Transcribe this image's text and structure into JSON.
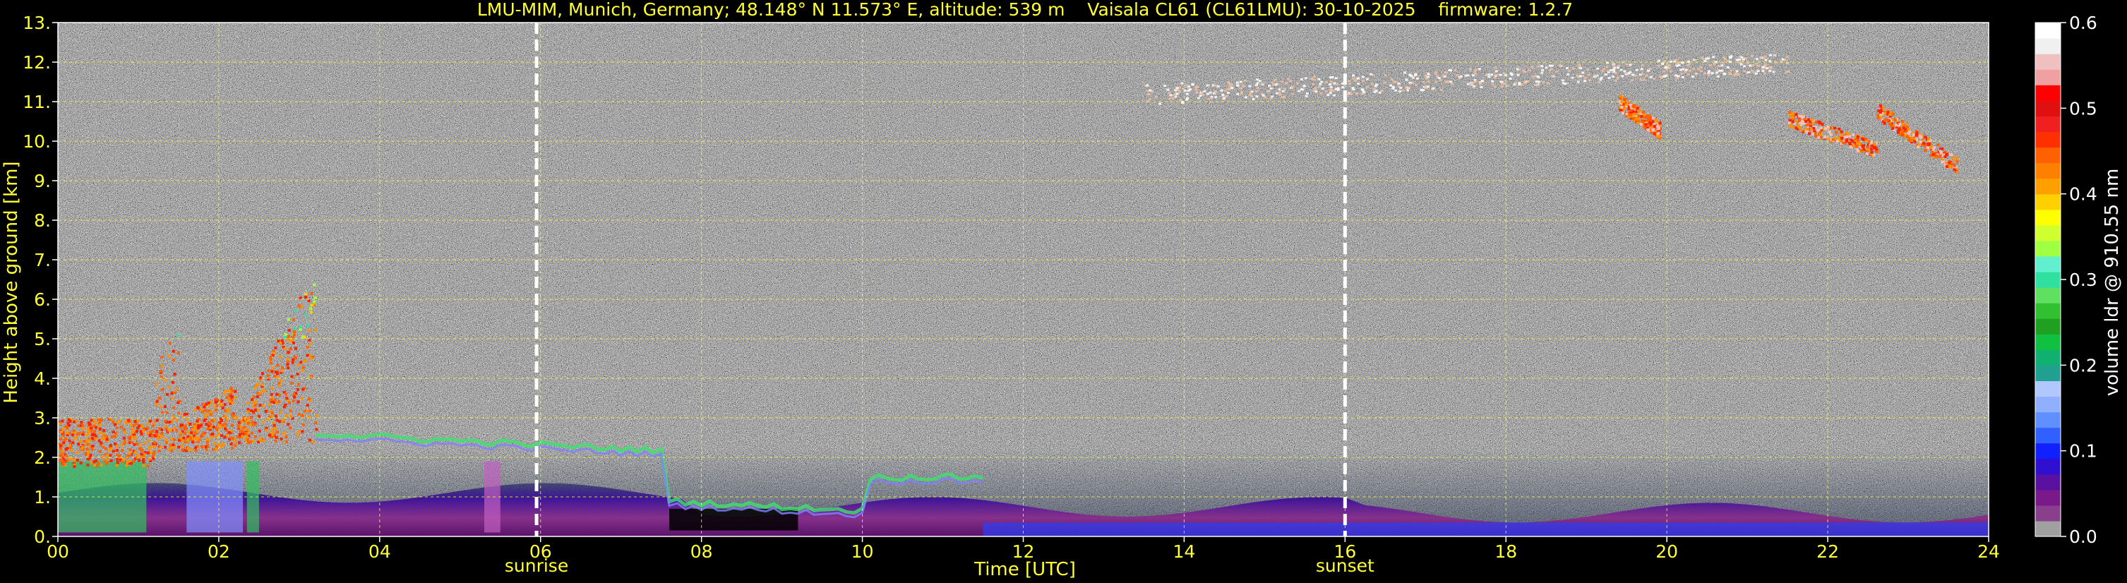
{
  "chart_data": {
    "type": "heatmap",
    "title": "LMU-MIM, Munich, Germany; 48.148° N 11.573° E, altitude: 539 m    Vaisala CL61 (CL61LMU): 30-10-2025    firmware: 1.2.7",
    "xlabel": "Time [UTC]",
    "ylabel": "Height above ground [km]",
    "xlim": [
      0,
      24
    ],
    "ylim": [
      0,
      13
    ],
    "x_ticks": [
      0,
      2,
      4,
      6,
      8,
      10,
      12,
      14,
      16,
      18,
      20,
      22,
      24
    ],
    "x_tick_labels": [
      "00",
      "02",
      "04",
      "06",
      "08",
      "10",
      "12",
      "14",
      "16",
      "18",
      "20",
      "22",
      "24"
    ],
    "y_ticks": [
      0,
      1,
      2,
      3,
      4,
      5,
      6,
      7,
      8,
      9,
      10,
      11,
      12,
      13
    ],
    "y_tick_labels": [
      "0.",
      "1.",
      "2.",
      "3.",
      "4.",
      "5.",
      "6.",
      "7.",
      "8.",
      "9.",
      "10.",
      "11.",
      "12.",
      "13."
    ],
    "grid": true,
    "markers": [
      {
        "label": "sunrise",
        "x": 5.95
      },
      {
        "label": "sunset",
        "x": 16.0
      }
    ],
    "colorbar": {
      "label": "volume ldr @ 910.55 nm",
      "range": [
        0.0,
        0.6
      ],
      "ticks": [
        0.0,
        0.1,
        0.2,
        0.3,
        0.4,
        0.5,
        0.6
      ],
      "tick_labels": [
        "0.0",
        "0.1",
        "0.2",
        "0.3",
        "0.4",
        "0.5",
        "0.6"
      ],
      "colors": [
        "#a0a0a0",
        "#8a3f8c",
        "#7a1a8a",
        "#5a10a0",
        "#3010d0",
        "#1020ff",
        "#3060ff",
        "#6090ff",
        "#90b0ff",
        "#b0c8ff",
        "#20a090",
        "#10b070",
        "#10c040",
        "#20a020",
        "#30c030",
        "#60e060",
        "#30e0a0",
        "#60f0d0",
        "#a0ff40",
        "#d0ff30",
        "#ffff00",
        "#ffd000",
        "#ffa000",
        "#ff8000",
        "#ff6000",
        "#ff3000",
        "#f02020",
        "#e01010",
        "#ff0000",
        "#f0a0a0",
        "#f0c0c0",
        "#f0f0f0",
        "#ffffff"
      ]
    },
    "features": [
      {
        "label": "",
        "kind": "boundary layer aerosol",
        "x": [
          0,
          24
        ],
        "y": [
          0,
          1.0
        ]
      },
      {
        "label": "",
        "kind": "cloud layer",
        "x": [
          0,
          1.2
        ],
        "y": [
          1.8,
          3.0
        ]
      },
      {
        "label": "",
        "kind": "cloud layer",
        "x": [
          1.2,
          3.2
        ],
        "y": [
          2.2,
          7.5
        ]
      },
      {
        "label": "",
        "kind": "cirrus",
        "x": [
          13.5,
          21.5
        ],
        "y": [
          11.0,
          12.2
        ]
      },
      {
        "label": "",
        "kind": "cirrus",
        "x": [
          19.3,
          23.6
        ],
        "y": [
          9.4,
          11.0
        ]
      }
    ]
  }
}
